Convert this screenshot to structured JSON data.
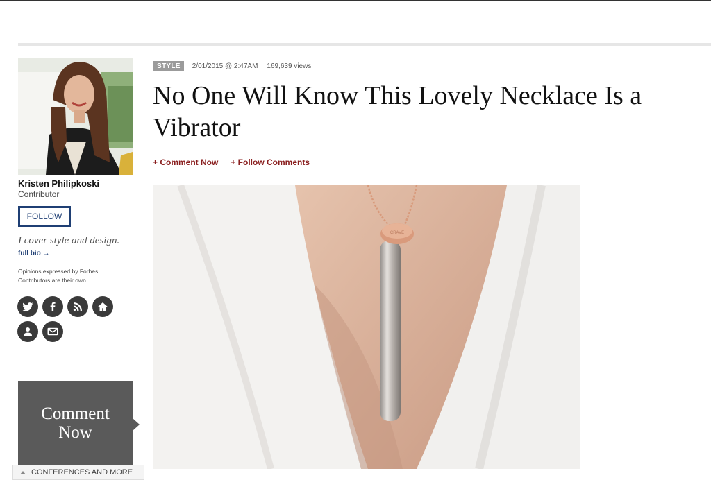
{
  "author": {
    "name": "Kristen Philipkoski",
    "role": "Contributor",
    "follow_label": "FOLLOW",
    "tagline": "I cover style and design.",
    "full_bio_label": "full bio →",
    "disclaimer": "Opinions expressed by Forbes Contributors are their own.",
    "social_icons": [
      "twitter-icon",
      "facebook-icon",
      "rss-icon",
      "home-icon",
      "profile-icon",
      "email-icon"
    ]
  },
  "article": {
    "section_tag": "STYLE",
    "date": "2/01/2015 @ 2:47AM",
    "views": "169,639 views",
    "title": "No One Will Know This Lovely Necklace Is a Vibrator",
    "comment_now": "+ Comment Now",
    "follow_comments": "+ Follow Comments",
    "pendant_engraving": "CRAVE"
  },
  "comment_box": {
    "line1": "Comment",
    "line2": "Now"
  },
  "conferences_label": "CONFERENCES AND MORE"
}
